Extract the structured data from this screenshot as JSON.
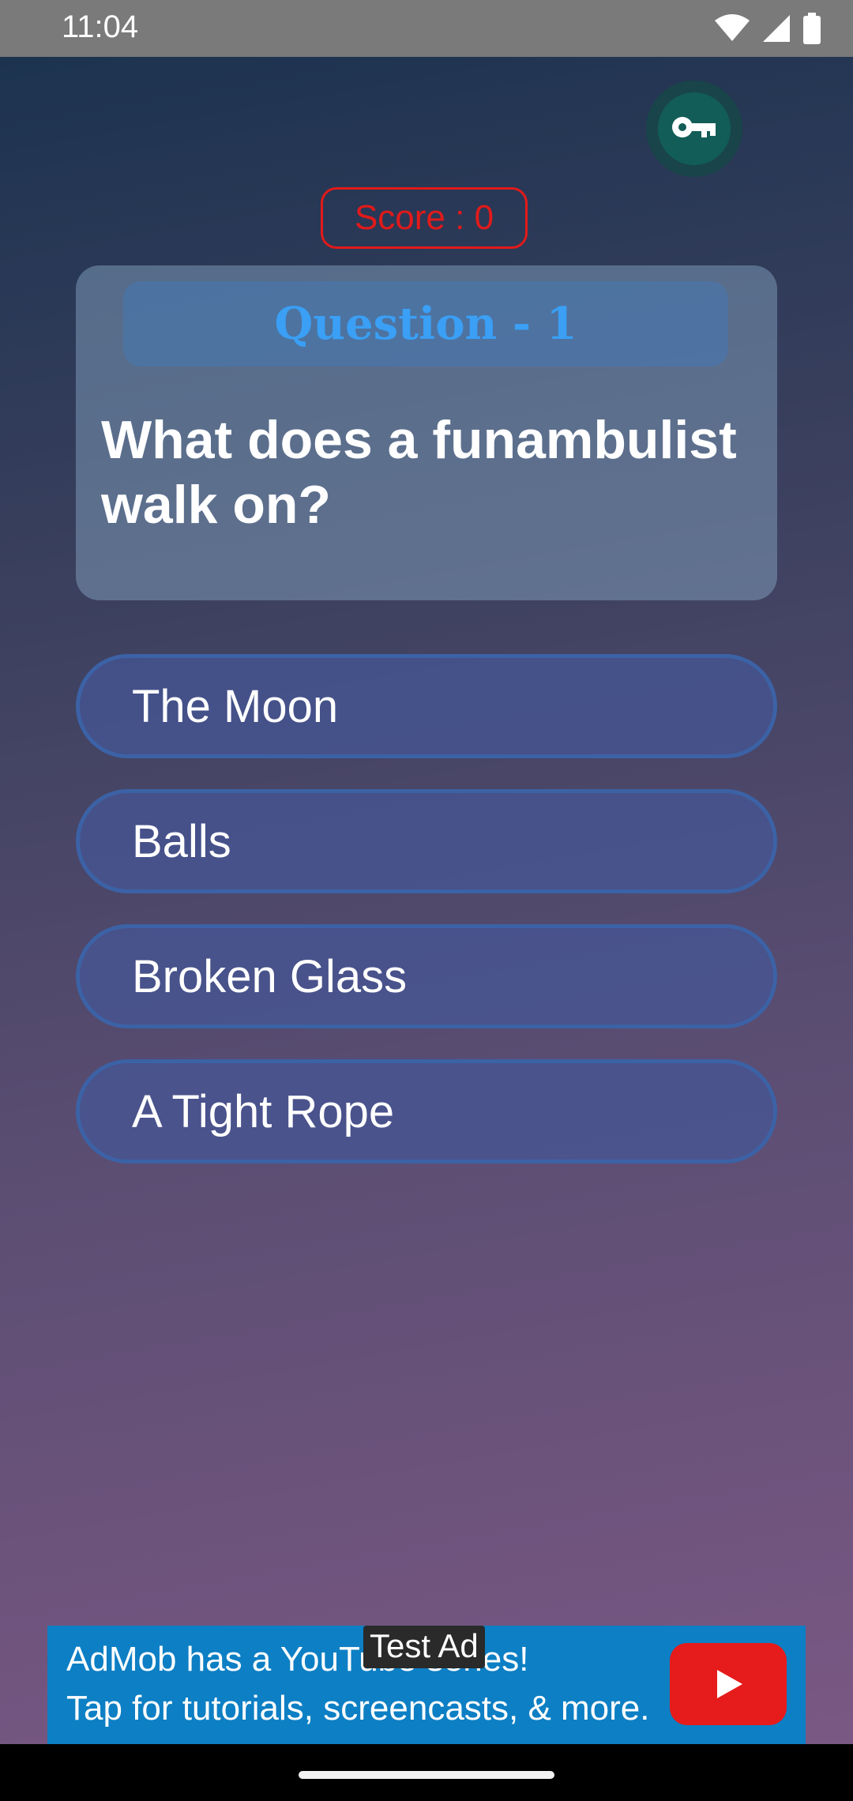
{
  "status_bar": {
    "time": "11:04",
    "icons": [
      "wifi-icon",
      "signal-icon",
      "battery-icon"
    ]
  },
  "key_button": {
    "icon": "key-icon"
  },
  "score": {
    "label": "Score : 0"
  },
  "question": {
    "header": "Question - 1",
    "text": "What does a funambulist walk on?"
  },
  "answers": [
    {
      "label": "The Moon"
    },
    {
      "label": "Balls"
    },
    {
      "label": "Broken Glass"
    },
    {
      "label": "A Tight Rope"
    }
  ],
  "ad": {
    "badge": "Test Ad",
    "line1": "AdMob has a YouTube series!",
    "line2": "Tap for tutorials, screencasts, & more.",
    "icon": "youtube-play-icon"
  },
  "colors": {
    "score": "#e11a1a",
    "question_header": "#3a9ff5",
    "ad_background": "#0d7fc4"
  }
}
